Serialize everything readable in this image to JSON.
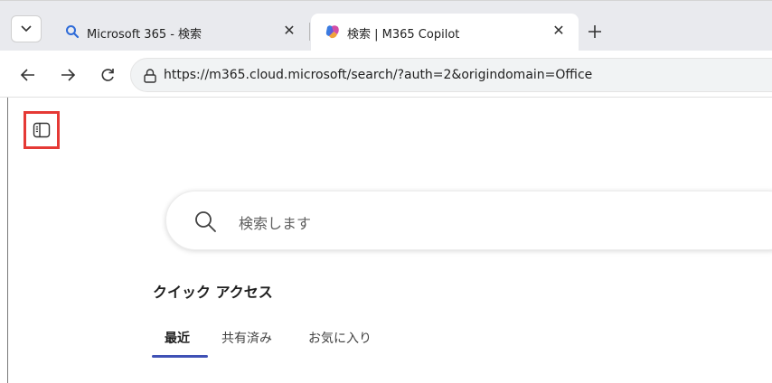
{
  "browser": {
    "tabs": [
      {
        "title": "Microsoft 365 - 検索",
        "icon": "search-icon",
        "active": false
      },
      {
        "title": "検索 | M365 Copilot",
        "icon": "copilot-icon",
        "active": true
      }
    ],
    "address": "https://m365.cloud.microsoft/search/?auth=2&origindomain=Office"
  },
  "search": {
    "placeholder": "検索します"
  },
  "quick_access": {
    "title": "クイック アクセス",
    "tabs": [
      "最近",
      "共有済み",
      "お気に入り"
    ],
    "selected_index": 0
  },
  "colors": {
    "accent": "#3f51b5",
    "highlight": "#e53935"
  }
}
